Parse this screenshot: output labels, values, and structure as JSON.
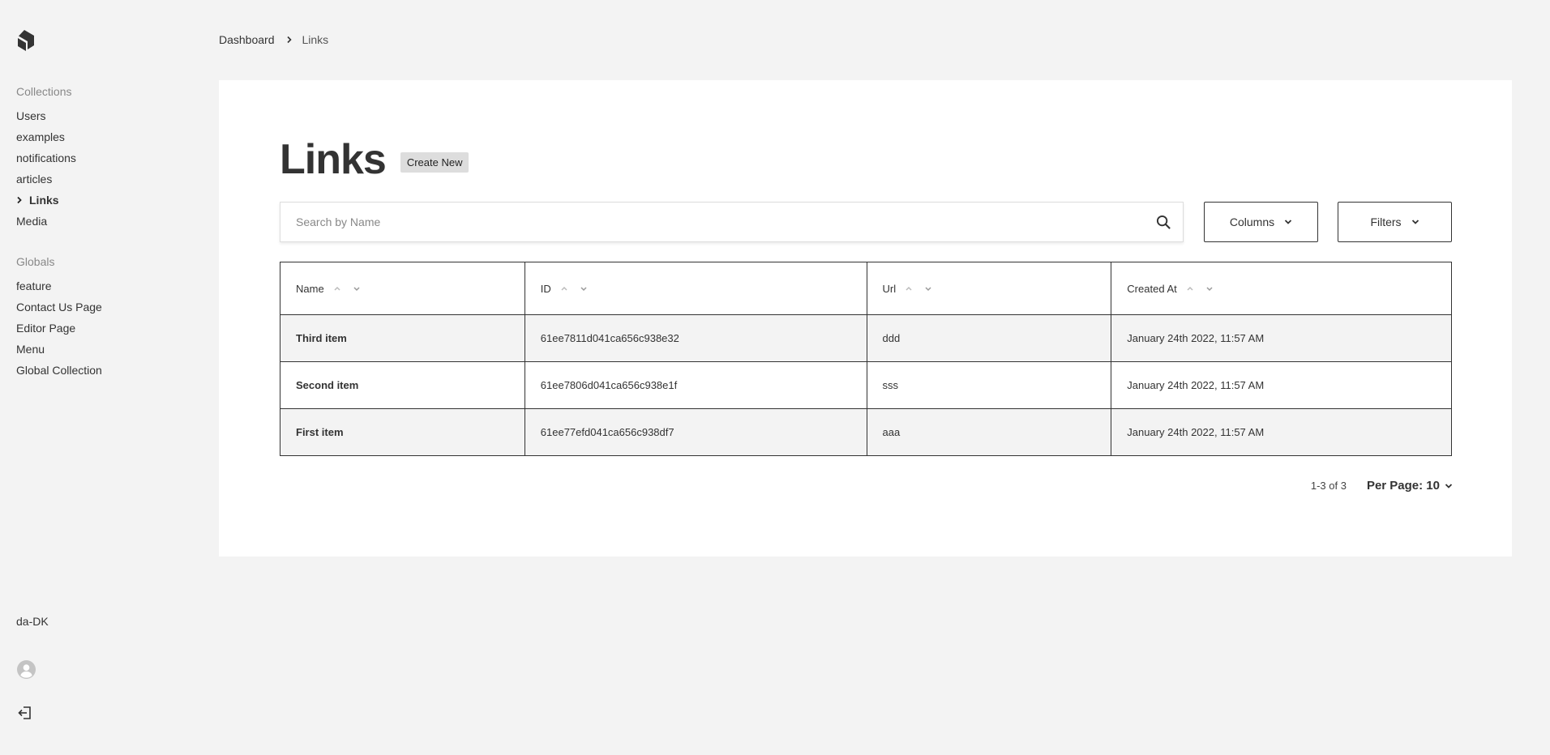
{
  "sidebar": {
    "collections_heading": "Collections",
    "collections": [
      {
        "label": "Users",
        "active": false
      },
      {
        "label": "examples",
        "active": false
      },
      {
        "label": "notifications",
        "active": false
      },
      {
        "label": "articles",
        "active": false
      },
      {
        "label": "Links",
        "active": true
      },
      {
        "label": "Media",
        "active": false
      }
    ],
    "globals_heading": "Globals",
    "globals": [
      {
        "label": "feature"
      },
      {
        "label": "Contact Us Page"
      },
      {
        "label": "Editor Page"
      },
      {
        "label": "Menu"
      },
      {
        "label": "Global Collection"
      }
    ],
    "locale": "da-DK",
    "icons": {
      "logo": "payload-logo-icon",
      "avatar": "user-avatar-icon",
      "logout": "logout-icon"
    }
  },
  "breadcrumb": {
    "dashboard": "Dashboard",
    "current": "Links"
  },
  "main": {
    "title": "Links",
    "create_new": "Create New",
    "search_placeholder": "Search by Name",
    "columns_label": "Columns",
    "filters_label": "Filters"
  },
  "table": {
    "columns": [
      "Name",
      "ID",
      "Url",
      "Created At"
    ],
    "rows": [
      {
        "name": "Third item",
        "id": "61ee7811d041ca656c938e32",
        "url": "ddd",
        "created_at": "January 24th 2022, 11:57 AM"
      },
      {
        "name": "Second item",
        "id": "61ee7806d041ca656c938e1f",
        "url": "sss",
        "created_at": "January 24th 2022, 11:57 AM"
      },
      {
        "name": "First item",
        "id": "61ee77efd041ca656c938df7",
        "url": "aaa",
        "created_at": "January 24th 2022, 11:57 AM"
      }
    ]
  },
  "pagination": {
    "info": "1-3 of 3",
    "per_page": "Per Page: 10"
  },
  "colors": {
    "background": "#f3f3f3",
    "panel": "#ffffff",
    "text": "#333333",
    "muted": "#888888",
    "button_bg": "#dddddd"
  }
}
